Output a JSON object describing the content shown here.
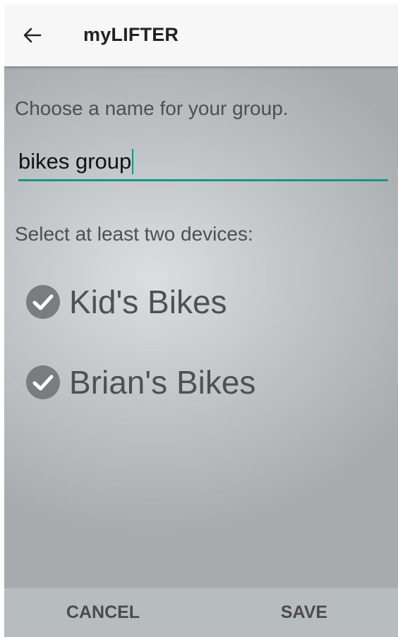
{
  "app_bar": {
    "title": "myLIFTER",
    "back_icon": "arrow-left-icon"
  },
  "form": {
    "name_prompt": "Choose a name for your group.",
    "name_value": "bikes group",
    "devices_prompt": "Select at least two devices:",
    "devices": [
      {
        "label": "Kid's Bikes",
        "checked": true,
        "icon": "check-circle-icon"
      },
      {
        "label": "Brian's Bikes",
        "checked": true,
        "icon": "check-circle-icon"
      }
    ]
  },
  "actions": {
    "cancel_label": "CANCEL",
    "save_label": "SAVE"
  },
  "colors": {
    "accent": "#14967f",
    "check_circle": "#7a7d80",
    "bottom_bar": "#b7bcbf"
  }
}
